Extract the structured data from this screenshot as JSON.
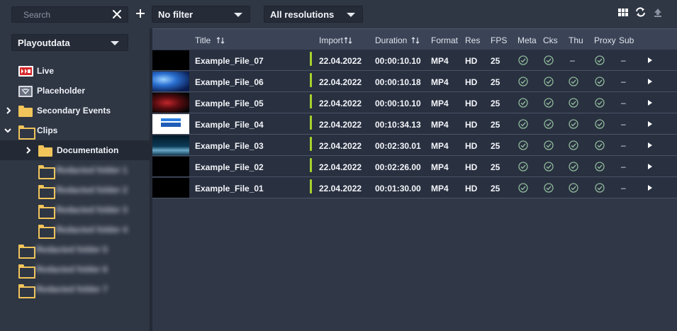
{
  "search": {
    "placeholder": "Search",
    "value": ""
  },
  "filters": {
    "filter_selected": "No filter",
    "resolution_selected": "All resolutions"
  },
  "toolbar_icons": [
    "grid-view-icon",
    "refresh-icon",
    "upload-icon"
  ],
  "sidebar": {
    "database_selected": "Playoutdata",
    "items": [
      {
        "label": "Live",
        "icon": "live-icon",
        "level": 0
      },
      {
        "label": "Placeholder",
        "icon": "placeholder-icon",
        "level": 0
      },
      {
        "label": "Secondary Events",
        "icon": "folder-icon",
        "level": 0,
        "expandable": true,
        "expanded": false
      },
      {
        "label": "Clips",
        "icon": "folder-open-icon",
        "level": 0,
        "expandable": true,
        "expanded": true
      },
      {
        "label": "Documentation",
        "icon": "folder-icon",
        "level": 1,
        "expandable": true,
        "expanded": false,
        "selected": true
      },
      {
        "label": "Redacted folder 1",
        "icon": "folder-icon",
        "level": 1,
        "blurred": true
      },
      {
        "label": "Redacted folder 2",
        "icon": "folder-icon",
        "level": 1,
        "blurred": true
      },
      {
        "label": "Redacted folder 3",
        "icon": "folder-icon",
        "level": 1,
        "blurred": true
      },
      {
        "label": "Redacted folder 4",
        "icon": "folder-icon",
        "level": 1,
        "blurred": true
      },
      {
        "label": "Redacted folder 5",
        "icon": "folder-icon",
        "level": 0,
        "blurred": true
      },
      {
        "label": "Redacted folder 6",
        "icon": "folder-icon",
        "level": 0,
        "blurred": true
      },
      {
        "label": "Redacted folder 7",
        "icon": "folder-icon",
        "level": 0,
        "blurred": true
      }
    ]
  },
  "table": {
    "columns": [
      "Title",
      "Import",
      "Duration",
      "Format",
      "Res",
      "FPS",
      "Meta",
      "Cks",
      "Thu",
      "Proxy",
      "Sub"
    ],
    "rows": [
      {
        "title": "Example_File_07",
        "import": "22.04.2022",
        "duration": "00:00:10.10",
        "format": "MP4",
        "res": "HD",
        "fps": "25",
        "meta": true,
        "cks": true,
        "thu": false,
        "proxy": true,
        "sub": false,
        "thumb": "black"
      },
      {
        "title": "Example_File_06",
        "import": "22.04.2022",
        "duration": "00:00:10.18",
        "format": "MP4",
        "res": "HD",
        "fps": "25",
        "meta": true,
        "cks": true,
        "thu": true,
        "proxy": true,
        "sub": false,
        "thumb": "blue"
      },
      {
        "title": "Example_File_05",
        "import": "22.04.2022",
        "duration": "00:00:10.10",
        "format": "MP4",
        "res": "HD",
        "fps": "25",
        "meta": true,
        "cks": true,
        "thu": true,
        "proxy": true,
        "sub": false,
        "thumb": "red"
      },
      {
        "title": "Example_File_04",
        "import": "22.04.2022",
        "duration": "00:10:34.13",
        "format": "MP4",
        "res": "HD",
        "fps": "25",
        "meta": true,
        "cks": true,
        "thu": true,
        "proxy": true,
        "sub": false,
        "thumb": "bunny"
      },
      {
        "title": "Example_File_03",
        "import": "22.04.2022",
        "duration": "00:02:30.01",
        "format": "MP4",
        "res": "HD",
        "fps": "25",
        "meta": true,
        "cks": true,
        "thu": true,
        "proxy": true,
        "sub": false,
        "thumb": "teal"
      },
      {
        "title": "Example_File_02",
        "import": "22.04.2022",
        "duration": "00:02:26.00",
        "format": "MP4",
        "res": "HD",
        "fps": "25",
        "meta": true,
        "cks": true,
        "thu": true,
        "proxy": true,
        "sub": false,
        "thumb": "black"
      },
      {
        "title": "Example_File_01",
        "import": "22.04.2022",
        "duration": "00:01:30.00",
        "format": "MP4",
        "res": "HD",
        "fps": "25",
        "meta": true,
        "cks": true,
        "thu": true,
        "proxy": true,
        "sub": false,
        "thumb": "black"
      }
    ],
    "dash_symbol": "–"
  },
  "colors": {
    "background": "#2f3644",
    "row_background": "#293040",
    "header_background": "#3b4457",
    "folder": "#f0c45a",
    "status_bar": "#a6d22e",
    "check": "#8fb99a"
  }
}
